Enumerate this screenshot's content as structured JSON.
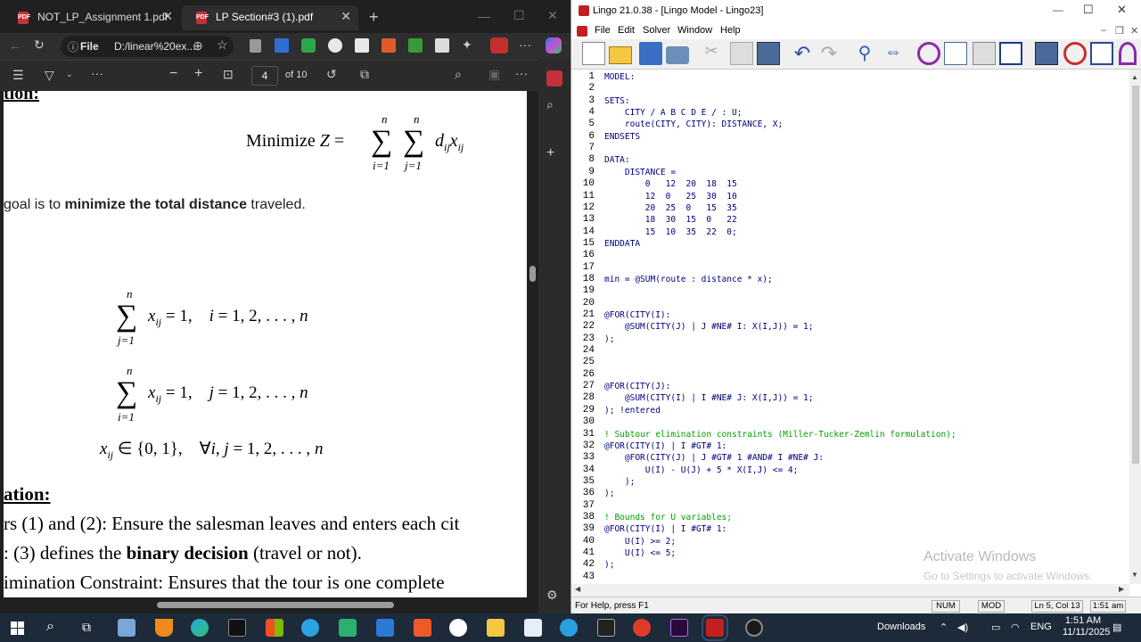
{
  "edge": {
    "tabs": [
      {
        "title": "NOT_LP_Assignment 1.pdf",
        "active": false
      },
      {
        "title": "LP Section#3 (1).pdf",
        "active": true
      }
    ],
    "address": {
      "scheme": "File",
      "url": "D:/linear%20ex..."
    },
    "pdf_toolbar": {
      "page": "4",
      "of_pages": "of 10"
    },
    "pdf_content": {
      "heading_fragment": "tion:",
      "objective": "Minimize Z = ∑∑ d_ij x_ij",
      "goal_prefix": "goal is to ",
      "goal_bold": "minimize the total distance",
      "goal_suffix": " traveled.",
      "constraint1": "∑ x_ij = 1,    i = 1, 2, . . . , n",
      "constraint2": "∑ x_ij = 1,    j = 1, 2, . . . , n",
      "constraint3": "x_ij ∈ {0, 1},    ∀i, j = 1, 2, . . . , n",
      "heading2": "ation:",
      "bullet1": "rs (1) and (2): Ensure the salesman leaves and enters each cit",
      "bullet2_prefix": ": (3) defines the ",
      "bullet2_bold": "binary decision",
      "bullet2_suffix": " (travel or not).",
      "bullet3": "imination Constraint: Ensures that the tour is one complete"
    }
  },
  "lingo": {
    "title": "Lingo 21.0.38 - [Lingo Model - Lingo23]",
    "menu": [
      "File",
      "Edit",
      "Solver",
      "Window",
      "Help"
    ],
    "code_lines": [
      {
        "n": "1",
        "t": "MODEL:",
        "c": false
      },
      {
        "n": "2",
        "t": "",
        "c": false
      },
      {
        "n": "3",
        "t": "SETS:",
        "c": false
      },
      {
        "n": "4",
        "t": "    CITY / A B C D E / : U;",
        "c": false
      },
      {
        "n": "5",
        "t": "    route(CITY, CITY): DISTANCE, X;",
        "c": false
      },
      {
        "n": "6",
        "t": "ENDSETS",
        "c": false
      },
      {
        "n": "7",
        "t": "",
        "c": false
      },
      {
        "n": "8",
        "t": "DATA:",
        "c": false
      },
      {
        "n": "9",
        "t": "    DISTANCE =",
        "c": false
      },
      {
        "n": "10",
        "t": "        0   12  20  18  15",
        "c": false
      },
      {
        "n": "11",
        "t": "        12  0   25  30  10",
        "c": false
      },
      {
        "n": "12",
        "t": "        20  25  0   15  35",
        "c": false
      },
      {
        "n": "13",
        "t": "        18  30  15  0   22",
        "c": false
      },
      {
        "n": "14",
        "t": "        15  10  35  22  0;",
        "c": false
      },
      {
        "n": "15",
        "t": "ENDDATA",
        "c": false
      },
      {
        "n": "16",
        "t": "",
        "c": false
      },
      {
        "n": "17",
        "t": "",
        "c": false
      },
      {
        "n": "18",
        "t": "min = @SUM(route : distance * x);",
        "c": false
      },
      {
        "n": "19",
        "t": "",
        "c": false
      },
      {
        "n": "20",
        "t": "",
        "c": false
      },
      {
        "n": "21",
        "t": "@FOR(CITY(I):",
        "c": false
      },
      {
        "n": "22",
        "t": "    @SUM(CITY(J) | J #NE# I: X(I,J)) = 1;",
        "c": false
      },
      {
        "n": "23",
        "t": ");",
        "c": false
      },
      {
        "n": "24",
        "t": "",
        "c": false
      },
      {
        "n": "25",
        "t": "",
        "c": false
      },
      {
        "n": "26",
        "t": "",
        "c": false
      },
      {
        "n": "27",
        "t": "@FOR(CITY(J):",
        "c": false
      },
      {
        "n": "28",
        "t": "    @SUM(CITY(I) | I #NE# J: X(I,J)) = 1;",
        "c": false
      },
      {
        "n": "29",
        "t": "); !entered",
        "c": false
      },
      {
        "n": "30",
        "t": "",
        "c": false
      },
      {
        "n": "31",
        "t": "! Subtour elimination constraints (Miller-Tucker-Zemlin formulation);",
        "c": true
      },
      {
        "n": "32",
        "t": "@FOR(CITY(I) | I #GT# 1:",
        "c": false
      },
      {
        "n": "33",
        "t": "    @FOR(CITY(J) | J #GT# 1 #AND# I #NE# J:",
        "c": false
      },
      {
        "n": "34",
        "t": "        U(I) - U(J) + 5 * X(I,J) <= 4;",
        "c": false
      },
      {
        "n": "35",
        "t": "    );",
        "c": false
      },
      {
        "n": "36",
        "t": ");",
        "c": false
      },
      {
        "n": "37",
        "t": "",
        "c": false
      },
      {
        "n": "38",
        "t": "! Bounds for U variables;",
        "c": true
      },
      {
        "n": "39",
        "t": "@FOR(CITY(I) | I #GT# 1:",
        "c": false
      },
      {
        "n": "40",
        "t": "    U(I) >= 2;",
        "c": false
      },
      {
        "n": "41",
        "t": "    U(I) <= 5;",
        "c": false
      },
      {
        "n": "42",
        "t": ");",
        "c": false
      },
      {
        "n": "43",
        "t": "",
        "c": false
      }
    ],
    "status": {
      "help": "For Help, press F1",
      "num": "NUM",
      "mod": "MOD",
      "pos": "Ln 5, Col 13",
      "time": "1:51 am"
    },
    "watermark": {
      "title": "Activate Windows",
      "sub": "Go to Settings to activate Windows."
    }
  },
  "taskbar": {
    "downloads": "Downloads",
    "lang": "ENG",
    "time": "1:51 AM",
    "date": "11/11/2025"
  }
}
